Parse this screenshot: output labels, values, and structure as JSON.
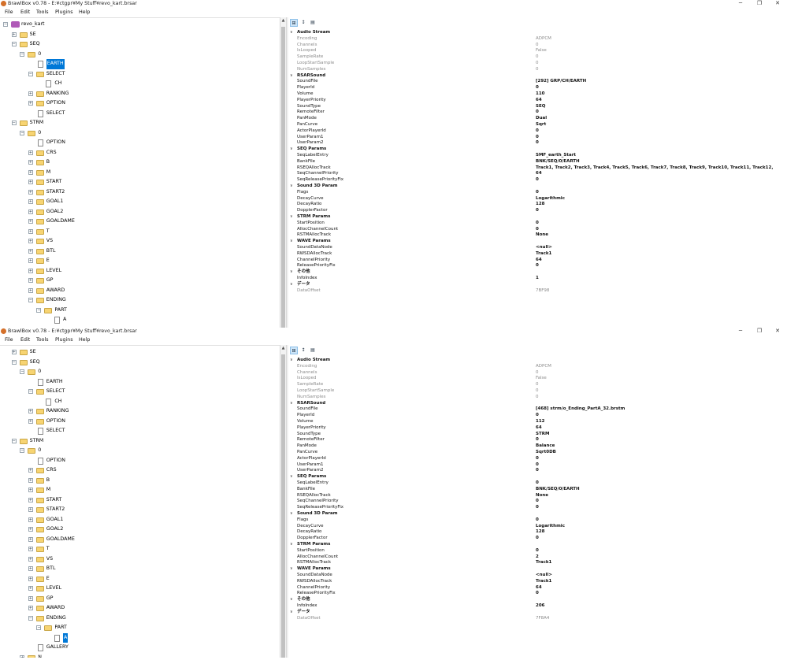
{
  "windows": [
    {
      "title": "BrawlBox v0.78 - E:¥ctgpr¥My Stuff¥revo_kart.brsar",
      "controls": {
        "minimize": "─",
        "maximize": "❐",
        "close": "✕"
      },
      "menu": [
        "File",
        "Edit",
        "Tools",
        "Plugins",
        "Help"
      ],
      "tree": [
        {
          "label": "revo_kart",
          "icon": "rsar",
          "indent": 0,
          "expander": "minus"
        },
        {
          "label": "SE",
          "icon": "folder",
          "indent": 1,
          "expander": "plus"
        },
        {
          "label": "SEQ",
          "icon": "folder",
          "indent": 1,
          "expander": "minus"
        },
        {
          "label": "0",
          "icon": "folder",
          "indent": 2,
          "expander": "minus"
        },
        {
          "label": "EARTH",
          "icon": "doc",
          "indent": 3,
          "expander": "",
          "selected": true
        },
        {
          "label": "SELECT",
          "icon": "folder",
          "indent": 3,
          "expander": "minus"
        },
        {
          "label": "CH",
          "icon": "doc",
          "indent": 4,
          "expander": ""
        },
        {
          "label": "RANKING",
          "icon": "folder",
          "indent": 3,
          "expander": "plus"
        },
        {
          "label": "OPTION",
          "icon": "folder",
          "indent": 3,
          "expander": "plus"
        },
        {
          "label": "SELECT",
          "icon": "doc",
          "indent": 3,
          "expander": ""
        },
        {
          "label": "STRM",
          "icon": "folder",
          "indent": 1,
          "expander": "minus"
        },
        {
          "label": "0",
          "icon": "folder",
          "indent": 2,
          "expander": "minus"
        },
        {
          "label": "OPTION",
          "icon": "doc",
          "indent": 3,
          "expander": ""
        },
        {
          "label": "CRS",
          "icon": "folder",
          "indent": 3,
          "expander": "plus"
        },
        {
          "label": "B",
          "icon": "folder",
          "indent": 3,
          "expander": "plus"
        },
        {
          "label": "M",
          "icon": "folder",
          "indent": 3,
          "expander": "plus"
        },
        {
          "label": "START",
          "icon": "folder",
          "indent": 3,
          "expander": "plus"
        },
        {
          "label": "START2",
          "icon": "folder",
          "indent": 3,
          "expander": "plus"
        },
        {
          "label": "GOAL1",
          "icon": "folder",
          "indent": 3,
          "expander": "plus"
        },
        {
          "label": "GOAL2",
          "icon": "folder",
          "indent": 3,
          "expander": "plus"
        },
        {
          "label": "GOALDAME",
          "icon": "folder",
          "indent": 3,
          "expander": "plus"
        },
        {
          "label": "T",
          "icon": "folder",
          "indent": 3,
          "expander": "plus"
        },
        {
          "label": "VS",
          "icon": "folder",
          "indent": 3,
          "expander": "plus"
        },
        {
          "label": "BTL",
          "icon": "folder",
          "indent": 3,
          "expander": "plus"
        },
        {
          "label": "E",
          "icon": "folder",
          "indent": 3,
          "expander": "plus"
        },
        {
          "label": "LEVEL",
          "icon": "folder",
          "indent": 3,
          "expander": "plus"
        },
        {
          "label": "GP",
          "icon": "folder",
          "indent": 3,
          "expander": "plus"
        },
        {
          "label": "AWARD",
          "icon": "folder",
          "indent": 3,
          "expander": "plus"
        },
        {
          "label": "ENDING",
          "icon": "folder",
          "indent": 3,
          "expander": "minus"
        },
        {
          "label": "PART",
          "icon": "folder",
          "indent": 4,
          "expander": "minus"
        },
        {
          "label": "A",
          "icon": "doc",
          "indent": 5,
          "expander": ""
        }
      ],
      "toolbar": [
        "⊞",
        "↕",
        "▤"
      ],
      "properties": [
        {
          "cat": "Audio Stream",
          "props": [
            {
              "name": "Encoding",
              "value": "ADPCM",
              "ro": true
            },
            {
              "name": "Channels",
              "value": "0",
              "ro": true
            },
            {
              "name": "IsLooped",
              "value": "False",
              "ro": true
            },
            {
              "name": "SampleRate",
              "value": "0",
              "ro": true
            },
            {
              "name": "LoopStartSample",
              "value": "0",
              "ro": true
            },
            {
              "name": "NumSamples",
              "value": "0",
              "ro": true
            }
          ]
        },
        {
          "cat": "RSARSound",
          "props": [
            {
              "name": "SoundFile",
              "value": "[292] GRP/CH/EARTH"
            },
            {
              "name": "PlayerId",
              "value": "0"
            },
            {
              "name": "Volume",
              "value": "110"
            },
            {
              "name": "PlayerPriority",
              "value": "64"
            },
            {
              "name": "SoundType",
              "value": "SEQ"
            },
            {
              "name": "RemoteFilter",
              "value": "0"
            },
            {
              "name": "PanMode",
              "value": "Dual"
            },
            {
              "name": "PanCurve",
              "value": "Sqrt"
            },
            {
              "name": "ActorPlayerId",
              "value": "0"
            },
            {
              "name": "UserParam1",
              "value": "0"
            },
            {
              "name": "UserParam2",
              "value": "0"
            }
          ]
        },
        {
          "cat": "SEQ Params",
          "props": [
            {
              "name": "SeqLabelEntry",
              "value": "SMF_earth_Start"
            },
            {
              "name": "BankFile",
              "value": "BNK/SEQ/0/EARTH"
            },
            {
              "name": "RSEQAllocTrack",
              "value": "Track1, Track2, Track3, Track4, Track5, Track6, Track7, Track8, Track9, Track10, Track11, Track12,"
            },
            {
              "name": "SeqChannelPriority",
              "value": "64"
            },
            {
              "name": "SeqReleasePriorityFix",
              "value": "0"
            }
          ]
        },
        {
          "cat": "Sound 3D Param",
          "props": [
            {
              "name": "Flags",
              "value": "0"
            },
            {
              "name": "DecayCurve",
              "value": "Logarithmic"
            },
            {
              "name": "DecayRatio",
              "value": "128"
            },
            {
              "name": "DopplerFactor",
              "value": "0"
            }
          ]
        },
        {
          "cat": "STRM Params",
          "props": [
            {
              "name": "StartPosition",
              "value": "0"
            },
            {
              "name": "AllocChannelCount",
              "value": "0"
            },
            {
              "name": "RSTMAllocTrack",
              "value": "None"
            }
          ]
        },
        {
          "cat": "WAVE Params",
          "props": [
            {
              "name": "SoundDataNode",
              "value": "<null>"
            },
            {
              "name": "RWSDAllocTrack",
              "value": "Track1"
            },
            {
              "name": "ChannelPriority",
              "value": "64"
            },
            {
              "name": "ReleasePriorityFix",
              "value": "0"
            }
          ]
        },
        {
          "cat": "その他",
          "props": [
            {
              "name": "InfoIndex",
              "value": "1"
            }
          ]
        },
        {
          "cat": "データ",
          "props": [
            {
              "name": "DataOffset",
              "value": "7BF98",
              "ro": true
            }
          ]
        }
      ]
    },
    {
      "title": "BrawlBox v0.78 - E:¥ctgpr¥My Stuff¥revo_kart.brsar",
      "controls": {
        "minimize": "─",
        "maximize": "❐",
        "close": "✕"
      },
      "menu": [
        "File",
        "Edit",
        "Tools",
        "Plugins",
        "Help"
      ],
      "tree": [
        {
          "label": "SE",
          "icon": "folder",
          "indent": 1,
          "expander": "plus"
        },
        {
          "label": "SEQ",
          "icon": "folder",
          "indent": 1,
          "expander": "minus"
        },
        {
          "label": "0",
          "icon": "folder",
          "indent": 2,
          "expander": "minus"
        },
        {
          "label": "EARTH",
          "icon": "doc",
          "indent": 3,
          "expander": ""
        },
        {
          "label": "SELECT",
          "icon": "folder",
          "indent": 3,
          "expander": "minus"
        },
        {
          "label": "CH",
          "icon": "doc",
          "indent": 4,
          "expander": ""
        },
        {
          "label": "RANKING",
          "icon": "folder",
          "indent": 3,
          "expander": "plus"
        },
        {
          "label": "OPTION",
          "icon": "folder",
          "indent": 3,
          "expander": "plus"
        },
        {
          "label": "SELECT",
          "icon": "doc",
          "indent": 3,
          "expander": ""
        },
        {
          "label": "STRM",
          "icon": "folder",
          "indent": 1,
          "expander": "minus"
        },
        {
          "label": "0",
          "icon": "folder",
          "indent": 2,
          "expander": "minus"
        },
        {
          "label": "OPTION",
          "icon": "doc",
          "indent": 3,
          "expander": ""
        },
        {
          "label": "CRS",
          "icon": "folder",
          "indent": 3,
          "expander": "plus"
        },
        {
          "label": "B",
          "icon": "folder",
          "indent": 3,
          "expander": "plus"
        },
        {
          "label": "M",
          "icon": "folder",
          "indent": 3,
          "expander": "plus"
        },
        {
          "label": "START",
          "icon": "folder",
          "indent": 3,
          "expander": "plus"
        },
        {
          "label": "START2",
          "icon": "folder",
          "indent": 3,
          "expander": "plus"
        },
        {
          "label": "GOAL1",
          "icon": "folder",
          "indent": 3,
          "expander": "plus"
        },
        {
          "label": "GOAL2",
          "icon": "folder",
          "indent": 3,
          "expander": "plus"
        },
        {
          "label": "GOALDAME",
          "icon": "folder",
          "indent": 3,
          "expander": "plus"
        },
        {
          "label": "T",
          "icon": "folder",
          "indent": 3,
          "expander": "plus"
        },
        {
          "label": "VS",
          "icon": "folder",
          "indent": 3,
          "expander": "plus"
        },
        {
          "label": "BTL",
          "icon": "folder",
          "indent": 3,
          "expander": "plus"
        },
        {
          "label": "E",
          "icon": "folder",
          "indent": 3,
          "expander": "plus"
        },
        {
          "label": "LEVEL",
          "icon": "folder",
          "indent": 3,
          "expander": "plus"
        },
        {
          "label": "GP",
          "icon": "folder",
          "indent": 3,
          "expander": "plus"
        },
        {
          "label": "AWARD",
          "icon": "folder",
          "indent": 3,
          "expander": "plus"
        },
        {
          "label": "ENDING",
          "icon": "folder",
          "indent": 3,
          "expander": "minus"
        },
        {
          "label": "PART",
          "icon": "folder",
          "indent": 4,
          "expander": "minus"
        },
        {
          "label": "A",
          "icon": "doc",
          "indent": 5,
          "expander": "",
          "selected": true
        },
        {
          "label": "GALLERY",
          "icon": "doc",
          "indent": 3,
          "expander": ""
        },
        {
          "label": "N",
          "icon": "folder",
          "indent": 2,
          "expander": "plus"
        }
      ],
      "toolbar": [
        "⊞",
        "↕",
        "▤"
      ],
      "properties": [
        {
          "cat": "Audio Stream",
          "props": [
            {
              "name": "Encoding",
              "value": "ADPCM",
              "ro": true
            },
            {
              "name": "Channels",
              "value": "0",
              "ro": true
            },
            {
              "name": "IsLooped",
              "value": "False",
              "ro": true
            },
            {
              "name": "SampleRate",
              "value": "0",
              "ro": true
            },
            {
              "name": "LoopStartSample",
              "value": "0",
              "ro": true
            },
            {
              "name": "NumSamples",
              "value": "0",
              "ro": true
            }
          ]
        },
        {
          "cat": "RSARSound",
          "props": [
            {
              "name": "SoundFile",
              "value": "[468] strm/o_Ending_PartA_32.brstm"
            },
            {
              "name": "PlayerId",
              "value": "0"
            },
            {
              "name": "Volume",
              "value": "112"
            },
            {
              "name": "PlayerPriority",
              "value": "64"
            },
            {
              "name": "SoundType",
              "value": "STRM"
            },
            {
              "name": "RemoteFilter",
              "value": "0"
            },
            {
              "name": "PanMode",
              "value": "Balance"
            },
            {
              "name": "PanCurve",
              "value": "Sqrt0DB"
            },
            {
              "name": "ActorPlayerId",
              "value": "0"
            },
            {
              "name": "UserParam1",
              "value": "0"
            },
            {
              "name": "UserParam2",
              "value": "0"
            }
          ]
        },
        {
          "cat": "SEQ Params",
          "props": [
            {
              "name": "SeqLabelEntry",
              "value": "0"
            },
            {
              "name": "BankFile",
              "value": "BNK/SEQ/0/EARTH"
            },
            {
              "name": "RSEQAllocTrack",
              "value": "None"
            },
            {
              "name": "SeqChannelPriority",
              "value": "0"
            },
            {
              "name": "SeqReleasePriorityFix",
              "value": "0"
            }
          ]
        },
        {
          "cat": "Sound 3D Param",
          "props": [
            {
              "name": "Flags",
              "value": "0"
            },
            {
              "name": "DecayCurve",
              "value": "Logarithmic"
            },
            {
              "name": "DecayRatio",
              "value": "128"
            },
            {
              "name": "DopplerFactor",
              "value": "0"
            }
          ]
        },
        {
          "cat": "STRM Params",
          "props": [
            {
              "name": "StartPosition",
              "value": "0"
            },
            {
              "name": "AllocChannelCount",
              "value": "2"
            },
            {
              "name": "RSTMAllocTrack",
              "value": "Track1"
            }
          ]
        },
        {
          "cat": "WAVE Params",
          "props": [
            {
              "name": "SoundDataNode",
              "value": "<null>"
            },
            {
              "name": "RWSDAllocTrack",
              "value": "Track1"
            },
            {
              "name": "ChannelPriority",
              "value": "64"
            },
            {
              "name": "ReleasePriorityFix",
              "value": "0"
            }
          ]
        },
        {
          "cat": "その他",
          "props": [
            {
              "name": "InfoIndex",
              "value": "206"
            }
          ]
        },
        {
          "cat": "データ",
          "props": [
            {
              "name": "DataOffset",
              "value": "7F8A4",
              "ro": true
            }
          ]
        }
      ]
    }
  ]
}
